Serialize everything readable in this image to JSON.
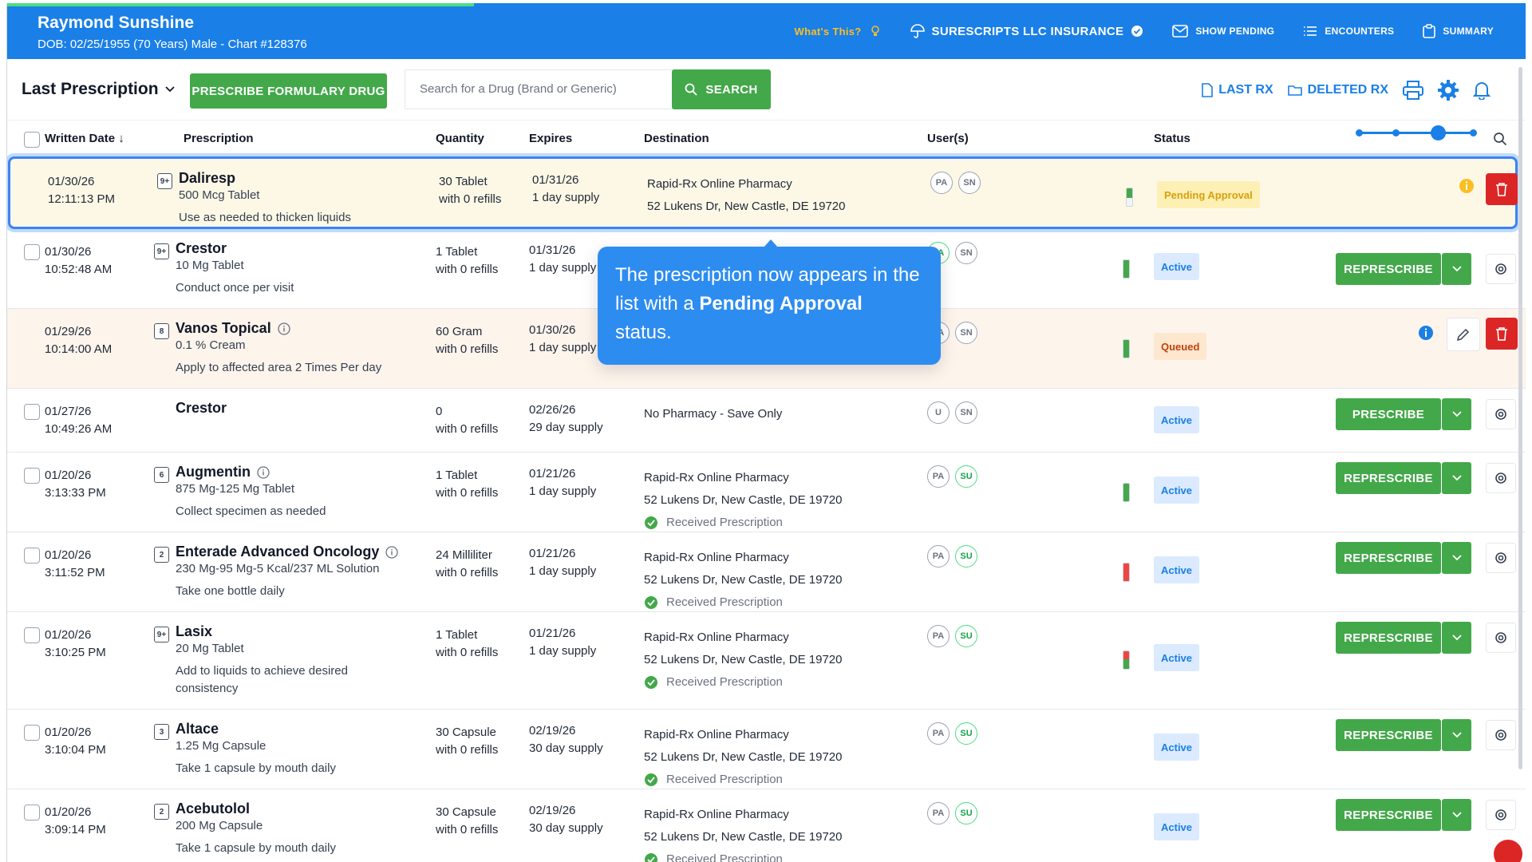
{
  "patient": {
    "name": "Raymond Sunshine",
    "details": "DOB: 02/25/1955 (70 Years) Male - Chart #128376"
  },
  "header_nav": {
    "whats_this": "What's This?",
    "insurance": "SURESCRIPTS LLC INSURANCE",
    "show_pending": "SHOW PENDING",
    "encounters": "ENCOUNTERS",
    "summary": "SUMMARY"
  },
  "toolbar": {
    "last_prescription": "Last Prescription",
    "prescribe_formulary": "PRESCRIBE FORMULARY DRUG",
    "search_placeholder": "Search for a Drug (Brand or Generic)",
    "search_label": "SEARCH",
    "last_rx": "LAST RX",
    "deleted_rx": "DELETED RX"
  },
  "columns": {
    "written_date": "Written Date",
    "prescription": "Prescription",
    "quantity": "Quantity",
    "expires": "Expires",
    "destination": "Destination",
    "users": "User(s)",
    "status": "Status"
  },
  "rows": [
    {
      "date": "01/30/26",
      "time": "12:11:13 PM",
      "badge": "9+",
      "drug": "Daliresp",
      "dose": "500 Mcg Tablet",
      "sig": "Use as needed to thicken liquids",
      "qty1": "30 Tablet",
      "qty2": "with 0 refills",
      "exp1": "01/31/26",
      "exp2": "1 day supply",
      "dest1": "Rapid-Rx Online Pharmacy",
      "dest2": "52 Lukens Dr, New Castle, DE 19720",
      "received": "",
      "users": [
        "PA",
        "SN"
      ],
      "status": "Pending Approval",
      "action": ""
    },
    {
      "date": "01/30/26",
      "time": "10:52:48 AM",
      "badge": "9+",
      "drug": "Crestor",
      "dose": "10 Mg Tablet",
      "sig": "Conduct once per visit",
      "qty1": "1 Tablet",
      "qty2": "with 0 refills",
      "exp1": "01/31/26",
      "exp2": "1 day supply",
      "dest1": "",
      "dest2": "",
      "received": "",
      "users": [
        "PA",
        "SN"
      ],
      "status": "Active",
      "action": "REPRESCRIBE"
    },
    {
      "date": "01/29/26",
      "time": "10:14:00 AM",
      "badge": "8",
      "drug": "Vanos Topical",
      "dose": "0.1 % Cream",
      "sig": "Apply to affected area 2 Times Per day",
      "qty1": "60 Gram",
      "qty2": "with 0 refills",
      "exp1": "01/30/26",
      "exp2": "1 day supply",
      "dest1": "",
      "dest2": "",
      "received": "",
      "users": [
        "PA",
        "SN"
      ],
      "status": "Queued",
      "action": ""
    },
    {
      "date": "01/27/26",
      "time": "10:49:26 AM",
      "badge": "",
      "drug": "Crestor",
      "dose": "",
      "sig": "",
      "qty1": "0",
      "qty2": "with 0 refills",
      "exp1": "02/26/26",
      "exp2": "29 day supply",
      "dest1": "No Pharmacy - Save Only",
      "dest2": "",
      "received": "",
      "users": [
        "U",
        "SN"
      ],
      "status": "Active",
      "action": "PRESCRIBE"
    },
    {
      "date": "01/20/26",
      "time": "3:13:33 PM",
      "badge": "6",
      "drug": "Augmentin",
      "dose": "875 Mg-125 Mg Tablet",
      "sig": "Collect specimen as needed",
      "qty1": "1 Tablet",
      "qty2": "with 0 refills",
      "exp1": "01/21/26",
      "exp2": "1 day supply",
      "dest1": "Rapid-Rx Online Pharmacy",
      "dest2": "52 Lukens Dr, New Castle, DE 19720",
      "received": "Received Prescription",
      "users": [
        "PA",
        "SU"
      ],
      "status": "Active",
      "action": "REPRESCRIBE"
    },
    {
      "date": "01/20/26",
      "time": "3:11:52 PM",
      "badge": "2",
      "drug": "Enterade Advanced Oncology",
      "dose": "230 Mg-95 Mg-5 Kcal/237 ML Solution",
      "sig": "Take one bottle daily",
      "qty1": "24 Milliliter",
      "qty2": "with 0 refills",
      "exp1": "01/21/26",
      "exp2": "1 day supply",
      "dest1": "Rapid-Rx Online Pharmacy",
      "dest2": "52 Lukens Dr, New Castle, DE 19720",
      "received": "Received Prescription",
      "users": [
        "PA",
        "SU"
      ],
      "status": "Active",
      "action": "REPRESCRIBE"
    },
    {
      "date": "01/20/26",
      "time": "3:10:25 PM",
      "badge": "9+",
      "drug": "Lasix",
      "dose": "20 Mg Tablet",
      "sig": "Add to liquids to achieve desired consistency",
      "qty1": "1 Tablet",
      "qty2": "with 0 refills",
      "exp1": "01/21/26",
      "exp2": "1 day supply",
      "dest1": "Rapid-Rx Online Pharmacy",
      "dest2": "52 Lukens Dr, New Castle, DE 19720",
      "received": "Received Prescription",
      "users": [
        "PA",
        "SU"
      ],
      "status": "Active",
      "action": "REPRESCRIBE"
    },
    {
      "date": "01/20/26",
      "time": "3:10:04 PM",
      "badge": "3",
      "drug": "Altace",
      "dose": "1.25 Mg Capsule",
      "sig": "Take 1 capsule by mouth daily",
      "qty1": "30 Capsule",
      "qty2": "with 0 refills",
      "exp1": "02/19/26",
      "exp2": "30 day supply",
      "dest1": "Rapid-Rx Online Pharmacy",
      "dest2": "52 Lukens Dr, New Castle, DE 19720",
      "received": "Received Prescription",
      "users": [
        "PA",
        "SU"
      ],
      "status": "Active",
      "action": "REPRESCRIBE"
    },
    {
      "date": "01/20/26",
      "time": "3:09:14 PM",
      "badge": "2",
      "drug": "Acebutolol",
      "dose": "200 Mg Capsule",
      "sig": "Take 1 capsule by mouth daily",
      "qty1": "30 Capsule",
      "qty2": "with 0 refills",
      "exp1": "02/19/26",
      "exp2": "30 day supply",
      "dest1": "Rapid-Rx Online Pharmacy",
      "dest2": "52 Lukens Dr, New Castle, DE 19720",
      "received": "Received Prescription",
      "users": [
        "PA",
        "SU"
      ],
      "status": "Active",
      "action": "REPRESCRIBE"
    }
  ],
  "callout": {
    "pre": "The prescription now appears in the list with a ",
    "bold": "Pending Approval",
    "post": " status."
  },
  "colors": {
    "header": "#1a7fe6",
    "green": "#43a84a",
    "red": "#dc2626"
  }
}
